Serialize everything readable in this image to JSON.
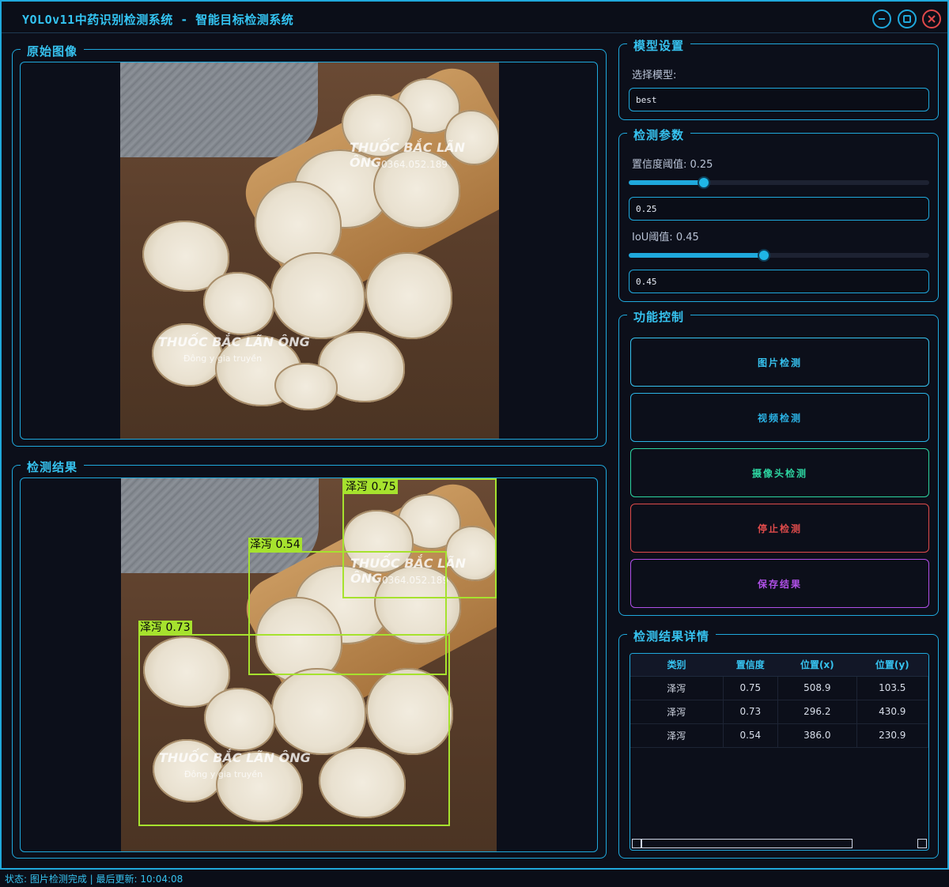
{
  "window": {
    "title": "YOLOv11中药识别检测系统 - 智能目标检测系统"
  },
  "original_panel": {
    "title": "原始图像"
  },
  "result_panel": {
    "title": "检测结果"
  },
  "model_panel": {
    "title": "模型设置",
    "select_label": "选择模型:",
    "model_value": "best"
  },
  "params_panel": {
    "title": "检测参数",
    "confidence_label": "置信度阈值: 0.25",
    "confidence_value": "0.25",
    "confidence_level": 0.25,
    "iou_label": "IoU阈值: 0.45",
    "iou_value": "0.45",
    "iou_level": 0.45
  },
  "control_panel": {
    "title": "功能控制",
    "buttons": [
      {
        "label": "图片检测",
        "color": "#36c2ef"
      },
      {
        "label": "视频检测",
        "color": "#2bb3e6"
      },
      {
        "label": "摄像头检测",
        "color": "#2dd4a0"
      },
      {
        "label": "停止检测",
        "color": "#e04b4b"
      },
      {
        "label": "保存结果",
        "color": "#b050e8"
      }
    ]
  },
  "details_panel": {
    "title": "检测结果详情",
    "columns": [
      "类别",
      "置信度",
      "位置(x)",
      "位置(y)"
    ],
    "rows": [
      [
        "泽泻",
        "0.75",
        "508.9",
        "103.5"
      ],
      [
        "泽泻",
        "0.73",
        "296.2",
        "430.9"
      ],
      [
        "泽泻",
        "0.54",
        "386.0",
        "230.9"
      ]
    ]
  },
  "detections": [
    {
      "label": "泽泻 0.75"
    },
    {
      "label": "泽泻 0.54"
    },
    {
      "label": "泽泻 0.73"
    }
  ],
  "photo_watermark": {
    "line1": "THUỐC BẮC LÃN ÔNG",
    "line2": "0364.052.189",
    "line3": "Đông y gia truyền"
  },
  "status_bar": {
    "text": "状态: 图片检测完成 | 最后更新: 10:04:08"
  },
  "colors": {
    "accent": "#1fa8dc",
    "box": "#a6e22e",
    "background": "#0c0f1a"
  }
}
